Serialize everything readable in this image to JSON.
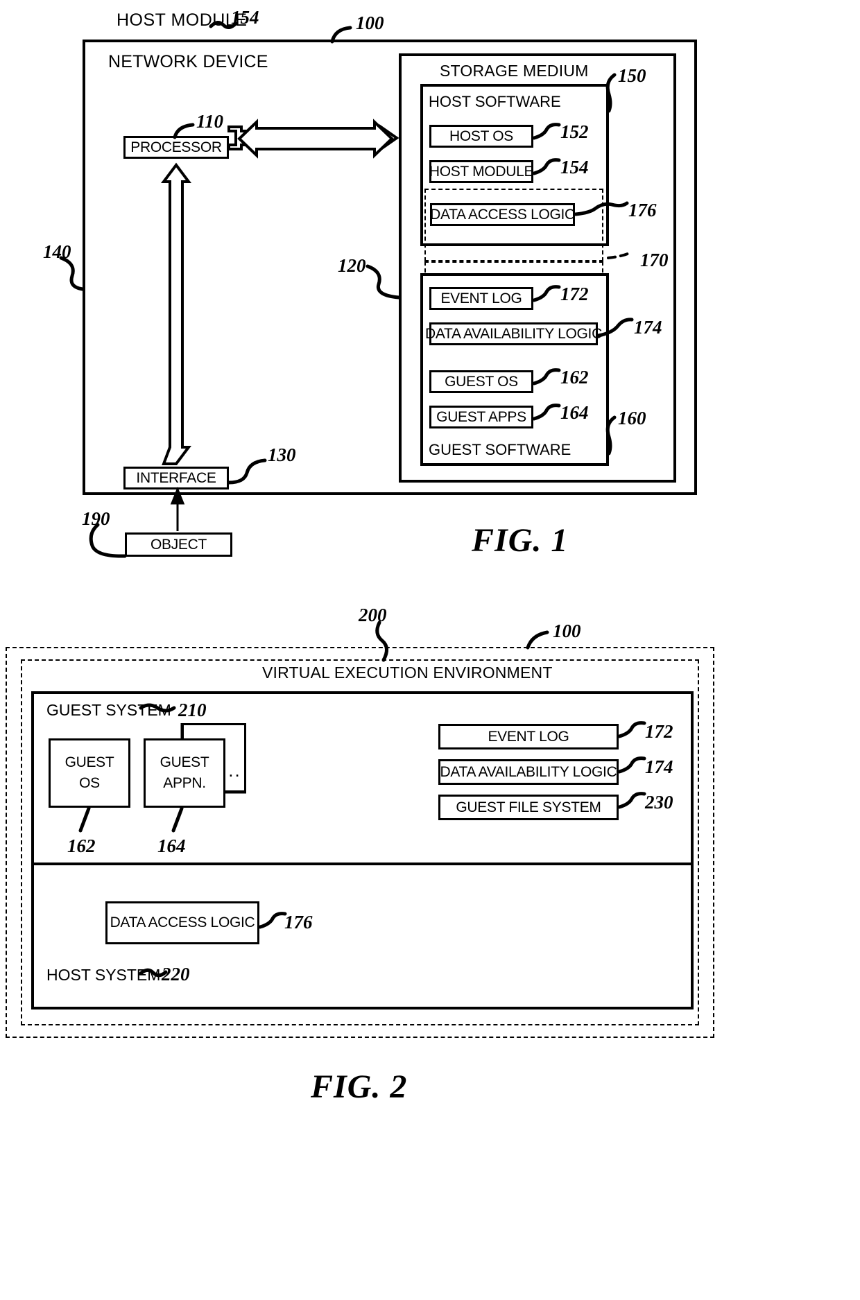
{
  "figures": [
    {
      "id": "fig1",
      "caption": "FIG. 1",
      "outer_label": "NETWORK DEVICE",
      "outer_ref": "100",
      "top_callout": "HOST MODULE",
      "top_callout_ref": "154",
      "left_ref": "140",
      "mid_ref": "120",
      "processor": {
        "label": "PROCESSOR",
        "ref": "110"
      },
      "interface": {
        "label": "INTERFACE",
        "ref": "130"
      },
      "object": {
        "label": "OBJECT",
        "ref": "190"
      },
      "storage_medium": {
        "label": "STORAGE MEDIUM"
      },
      "host_software": {
        "label": "HOST SOFTWARE",
        "ref": "150"
      },
      "guest_software": {
        "label": "GUEST SOFTWARE",
        "ref": "160"
      },
      "dashed_group_ref": "170",
      "boxes": [
        {
          "label": "HOST OS",
          "ref": "152"
        },
        {
          "label": "HOST MODULE",
          "ref": "154"
        },
        {
          "label": "DATA ACCESS LOGIC",
          "ref": "176"
        },
        {
          "label": "EVENT LOG",
          "ref": "172"
        },
        {
          "label": "DATA AVAILABILITY LOGIC",
          "ref": "174"
        },
        {
          "label": "GUEST OS",
          "ref": "162"
        },
        {
          "label": "GUEST APPS",
          "ref": "164"
        }
      ]
    },
    {
      "id": "fig2",
      "caption": "FIG. 2",
      "outer_ref": "100",
      "vee_label": "VIRTUAL EXECUTION ENVIRONMENT",
      "vee_ref": "200",
      "guest_system": {
        "label": "GUEST SYSTEM",
        "ref": "210"
      },
      "host_system": {
        "label": "HOST SYSTEM",
        "ref": "220"
      },
      "guest_os": {
        "line1": "GUEST",
        "line2": "OS",
        "ref": "162"
      },
      "guest_appn": {
        "line1": "GUEST",
        "line2": "APPN.",
        "ref": "164"
      },
      "ellipsis": "...",
      "right_boxes": [
        {
          "label": "EVENT LOG",
          "ref": "172"
        },
        {
          "label": "DATA AVAILABILITY LOGIC",
          "ref": "174"
        },
        {
          "label": "GUEST FILE SYSTEM",
          "ref": "230"
        }
      ],
      "data_access_logic": {
        "label": "DATA ACCESS LOGIC",
        "ref": "176"
      }
    }
  ]
}
